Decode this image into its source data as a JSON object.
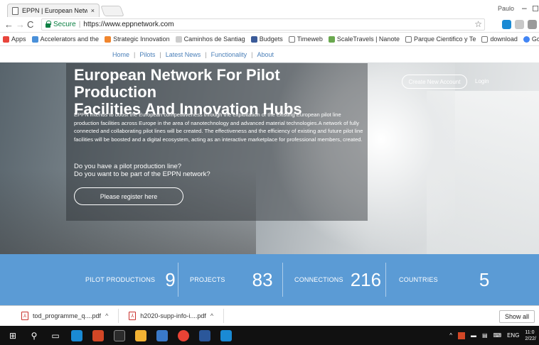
{
  "browser": {
    "tab_title": "EPPN | European Netwo",
    "tab_close": "×",
    "user_name": "Paulo",
    "secure_label": "Secure",
    "url": "https://www.eppnetwork.com",
    "bookmarks": [
      {
        "label": "Apps",
        "color": "#e8453c"
      },
      {
        "label": "Accelerators and the",
        "color": "#4a90d9"
      },
      {
        "label": "Strategic Innovation",
        "color": "#f0852d"
      },
      {
        "label": "Caminhos de Santiag",
        "color": "#cccccc"
      },
      {
        "label": "Budgets",
        "color": "#3b5b99"
      },
      {
        "label": "Timeweb",
        "color": "#999999"
      },
      {
        "label": "ScaleTravels | Nanote",
        "color": "#6aa84f"
      },
      {
        "label": "Parque Cientifico y Te",
        "color": "#999999"
      },
      {
        "label": "download",
        "color": "#999999"
      },
      {
        "label": "Google",
        "color": "#4285f4"
      }
    ]
  },
  "site": {
    "nav": [
      "Home",
      "Pilots",
      "Latest News",
      "Functionality",
      "About"
    ],
    "hero": {
      "title_line1": "European Network For Pilot Production",
      "title_line2": "Facilities And Innovation Hubs",
      "description": "EPPN intends to boost the European competitiveness through the exploitation of the existing European pilot line production facilities across Europe in the area of nanotechnology and advanced material technologies.A network of fully connected and collaborating pilot lines will be created. The effectiveness and the efficiency of existing and future pilot line facilities will be boosted and a digital ecosystem, acting as an interactive marketplace for professional members, created.",
      "question1": "Do you have a pilot production line?",
      "question2": "Do you want to be part of the EPPN network?",
      "register_label": "Please register here",
      "create_account_label": "Create New Account",
      "login_label": "Login"
    },
    "stats": [
      {
        "label": "PILOT PRODUCTIONS",
        "value": "9"
      },
      {
        "label": "PROJECTS",
        "value": "83"
      },
      {
        "label": "CONNECTIONS",
        "value": "216"
      },
      {
        "label": "COUNTRIES",
        "value": "5"
      }
    ],
    "accent_color": "#5b9bd5"
  },
  "downloads": {
    "items": [
      "tod_programme_q....pdf",
      "h2020-supp-info-i....pdf"
    ],
    "show_all": "Show all"
  },
  "taskbar": {
    "lang": "ENG",
    "time": "11:0",
    "date": "2/22/"
  }
}
